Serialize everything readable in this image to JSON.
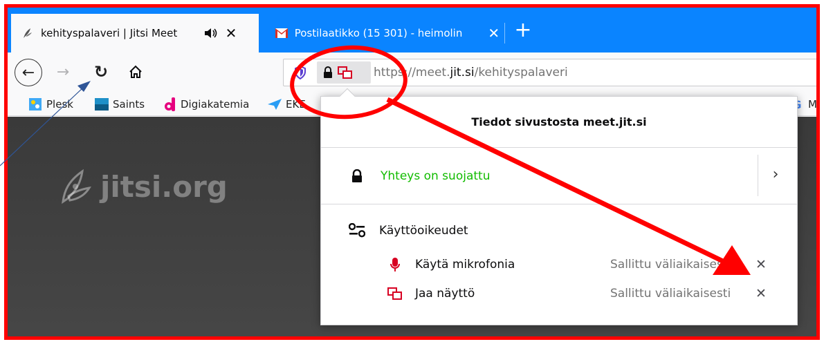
{
  "tabs": [
    {
      "title": "kehityspalaveri | Jitsi Meet",
      "active": true,
      "audio": true,
      "favicon": "jitsi-icon"
    },
    {
      "title": "Postilaatikko (15 301) - heimolin",
      "active": false,
      "audio": false,
      "favicon": "gmail-icon"
    }
  ],
  "toolbar": {
    "url_prefix": "https://meet.",
    "url_host": "jit.si",
    "url_path": "/kehityspalaveri"
  },
  "bookmarks": [
    {
      "label": "Plesk",
      "icon": "plesk-icon"
    },
    {
      "label": "Saints",
      "icon": "saints-icon"
    },
    {
      "label": "Digiakatemia",
      "icon": "digiakatemia-icon"
    },
    {
      "label": "EKE",
      "icon": "send-icon"
    },
    {
      "label": "Ma",
      "icon": "google-icon"
    }
  ],
  "page": {
    "logo_text": "jitsi.org"
  },
  "popup": {
    "title": "Tiedot sivustosta meet.jit.si",
    "connection": "Yhteys on suojattu",
    "permissions_title": "Käyttöoikeudet",
    "permissions": [
      {
        "label": "Käytä mikrofonia",
        "state": "Sallittu väliaikaisesti",
        "icon": "microphone-icon"
      },
      {
        "label": "Jaa näyttö",
        "state": "Sallittu väliaikaisesti",
        "icon": "screen-share-icon"
      }
    ]
  },
  "colors": {
    "accent": "#0a84ff",
    "secure_text": "#12bc00",
    "annotation": "#ff0000",
    "pointer_line": "#2f5597"
  }
}
